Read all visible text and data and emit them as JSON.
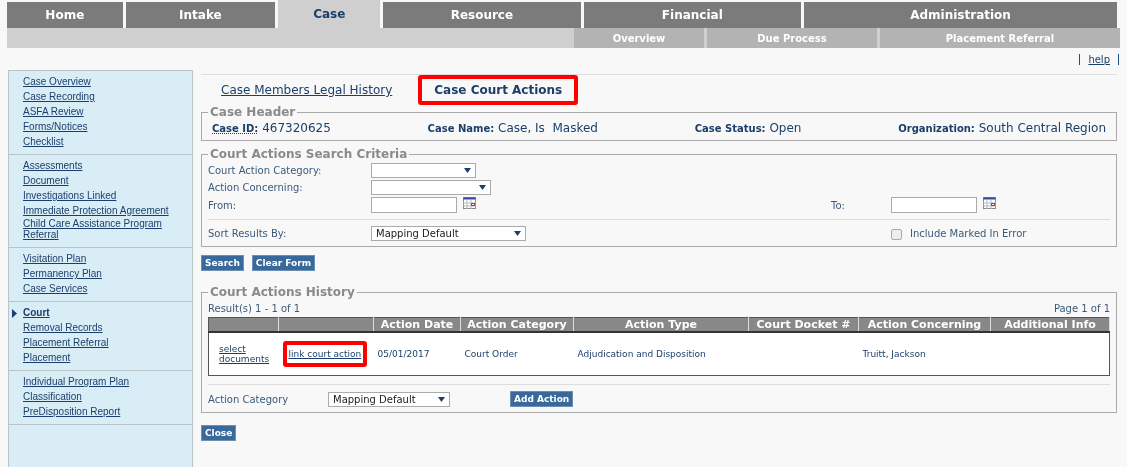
{
  "nav": [
    {
      "label": "Home",
      "selected": false
    },
    {
      "label": "Intake",
      "selected": false
    },
    {
      "label": "Case",
      "selected": true
    },
    {
      "label": "Resource",
      "selected": false
    },
    {
      "label": "Financial",
      "selected": false
    },
    {
      "label": "Administration",
      "selected": false
    }
  ],
  "subnav": [
    "Overview",
    "Due Process",
    "Placement Referral"
  ],
  "help": "help",
  "sidebar": {
    "groups": [
      [
        {
          "label": "Case Overview",
          "selected": false
        },
        {
          "label": "Case Recording",
          "selected": false
        },
        {
          "label": "ASFA Review",
          "selected": false
        },
        {
          "label": "Forms/Notices",
          "selected": false
        },
        {
          "label": "Checklist",
          "selected": false
        }
      ],
      [
        {
          "label": "Assessments",
          "selected": false
        },
        {
          "label": "Document",
          "selected": false
        },
        {
          "label": "Investigations Linked",
          "selected": false
        },
        {
          "label": "Immediate Protection Agreement",
          "selected": false
        },
        {
          "label": "Child Care Assistance Program Referral",
          "selected": false
        }
      ],
      [
        {
          "label": "Visitation Plan",
          "selected": false
        },
        {
          "label": "Permanency Plan",
          "selected": false
        },
        {
          "label": "Case Services",
          "selected": false
        }
      ],
      [
        {
          "label": "Court",
          "selected": true
        },
        {
          "label": "Removal Records",
          "selected": false
        },
        {
          "label": "Placement Referral",
          "selected": false
        },
        {
          "label": "Placement",
          "selected": false
        }
      ],
      [
        {
          "label": "Individual Program Plan",
          "selected": false
        },
        {
          "label": "Classification",
          "selected": false
        },
        {
          "label": "PreDisposition Report",
          "selected": false
        }
      ]
    ]
  },
  "tabs": [
    {
      "label": "Case Members Legal History",
      "selected": false,
      "highlighted": false
    },
    {
      "label": "Case Court Actions",
      "selected": true,
      "highlighted": true
    }
  ],
  "case_header": {
    "legend": "Case Header",
    "fields": [
      {
        "label": "Case ID:",
        "value": "467320625",
        "underlined": true
      },
      {
        "label": "Case Name:",
        "value": "Case, Is  Masked",
        "underlined": false
      },
      {
        "label": "Case Status:",
        "value": "Open",
        "underlined": false
      },
      {
        "label": "Organization:",
        "value": "South Central Region",
        "underlined": false
      }
    ]
  },
  "search_criteria": {
    "legend": "Court Actions Search Criteria",
    "court_action_category": {
      "label": "Court Action Category:"
    },
    "action_concerning": {
      "label": "Action Concerning:"
    },
    "from": {
      "label": "From:"
    },
    "to": {
      "label": "To:"
    },
    "sort_by": {
      "label": "Sort Results By:",
      "value": "Mapping Default"
    },
    "include_marked_in_error": {
      "label": "Include Marked In Error",
      "checked": false
    }
  },
  "search_buttons": [
    "Search",
    "Clear Form"
  ],
  "history": {
    "legend": "Court Actions History",
    "results": "Result(s) 1 - 1 of 1",
    "page": "Page 1 of 1",
    "columns": [
      "Action Date",
      "Action Category",
      "Action Type",
      "Court Docket #",
      "Action Concerning",
      "Additional Info"
    ],
    "rows": [
      {
        "links": [
          {
            "label": "select documents",
            "highlighted": false
          },
          {
            "label": "link court action",
            "highlighted": true
          }
        ],
        "cells": [
          "05/01/2017",
          "Court Order",
          "Adjudication and Disposition",
          "",
          "Truitt, Jackson",
          ""
        ]
      }
    ],
    "action_category": {
      "label": "Action Category",
      "value": "Mapping Default"
    },
    "add_button": "Add Action"
  },
  "close_button": "Close"
}
